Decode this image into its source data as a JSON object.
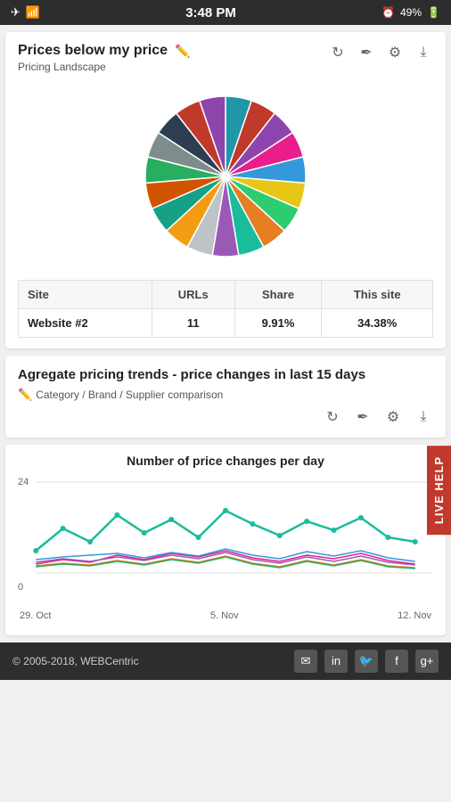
{
  "statusBar": {
    "time": "3:48 PM",
    "battery": "49%"
  },
  "card1": {
    "title": "Prices below my price",
    "subtitle": "Pricing Landscape",
    "table": {
      "headers": [
        "Site",
        "URLs",
        "Share",
        "This site"
      ],
      "rows": [
        {
          "site": "Website #2",
          "urls": "11",
          "share": "9.91%",
          "thissite": "34.38%"
        }
      ]
    },
    "actions": [
      "refresh",
      "eyedropper",
      "settings",
      "download"
    ]
  },
  "card2": {
    "title": "Agregate pricing trends - price changes in last 15 days",
    "subtitle": "Category / Brand / Supplier comparison",
    "actions": [
      "refresh",
      "eyedropper",
      "settings",
      "download"
    ]
  },
  "chart": {
    "title": "Number of price changes per day",
    "yLabels": {
      "top": "24",
      "zero": "0"
    },
    "xLabels": [
      "29. Oct",
      "5. Nov",
      "12. Nov"
    ]
  },
  "footer": {
    "copyright": "© 2005-2018, WEBCentric",
    "socialIcons": [
      "email",
      "linkedin",
      "twitter",
      "facebook",
      "google-plus"
    ]
  },
  "liveHelp": {
    "label": "LIVE HELP"
  },
  "pieColors": [
    "#2196a8",
    "#c0392b",
    "#8e44ad",
    "#e91e8c",
    "#3498db",
    "#e8c617",
    "#2ecc71",
    "#e67e22",
    "#1abc9c",
    "#9b59b6",
    "#bdc3c7",
    "#f39c12",
    "#16a085",
    "#d35400",
    "#27ae60",
    "#7f8c8d",
    "#2c3e50",
    "#c0392b",
    "#8e44ad"
  ]
}
